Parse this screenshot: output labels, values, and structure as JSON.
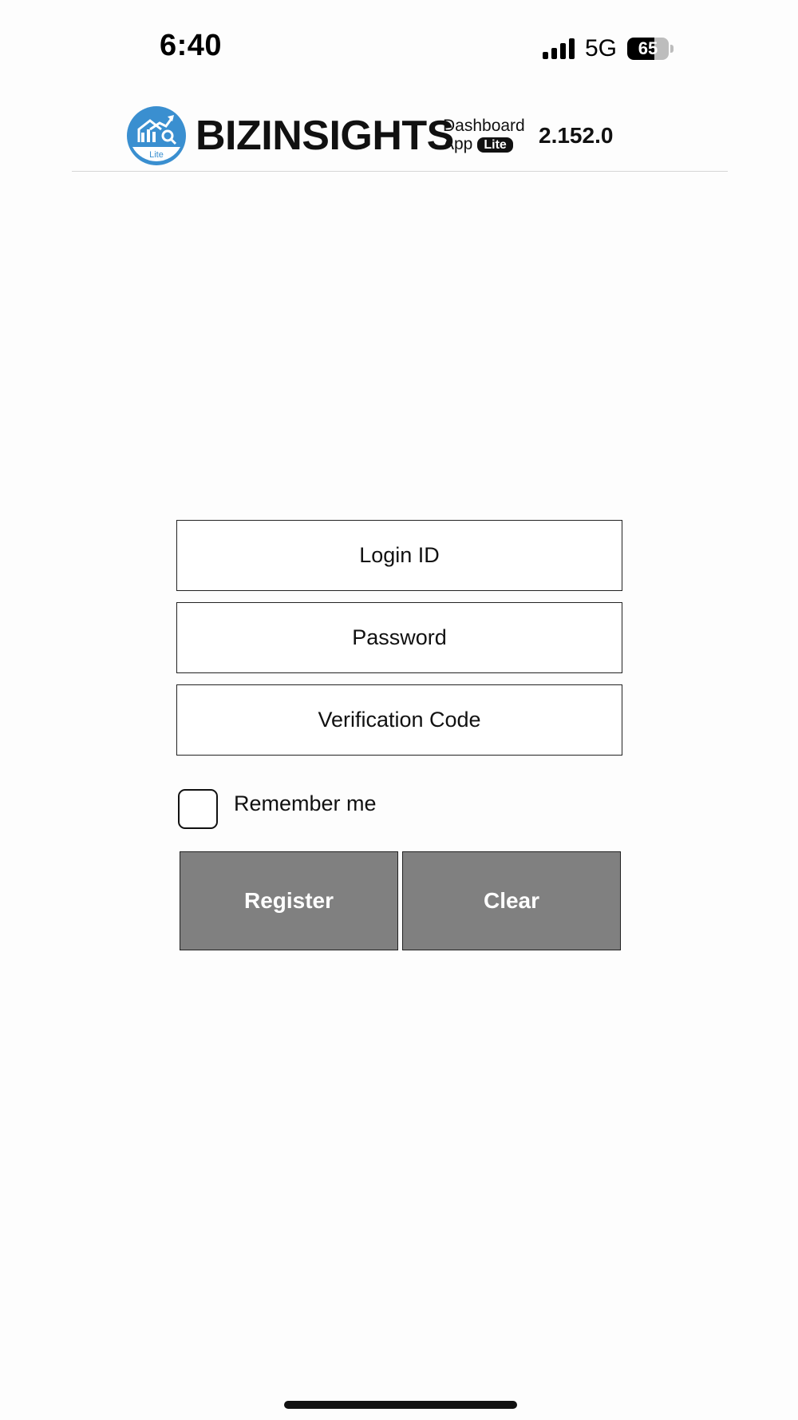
{
  "status_bar": {
    "time": "6:40",
    "network": "5G",
    "battery": "65",
    "battery_level": 0.65,
    "signal_icon": "cellular-signal-icon"
  },
  "header": {
    "brand": "BIZINSIGHTS",
    "subtitle_line1": "Dashboard",
    "subtitle_line2": "App",
    "badge": "Lite",
    "logo_badge": "Lite",
    "version": "2.152.0",
    "logo_color": "#3a8fd0"
  },
  "form": {
    "login_id_placeholder": "Login ID",
    "password_placeholder": "Password",
    "verification_placeholder": "Verification Code",
    "remember_label": "Remember me",
    "remember_checked": false,
    "register_label": "Register",
    "clear_label": "Clear",
    "button_color": "#808080"
  }
}
